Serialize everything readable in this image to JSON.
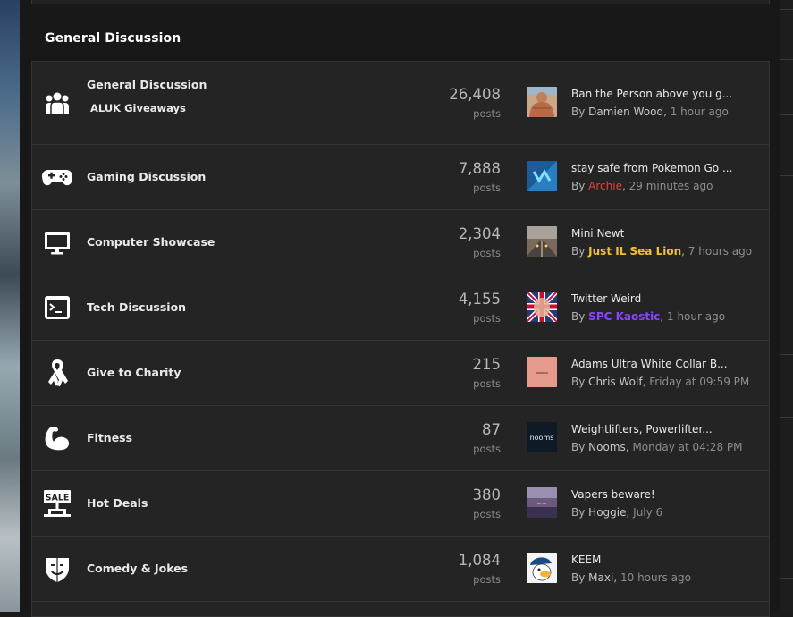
{
  "section": {
    "title": "General Discussion"
  },
  "forums": [
    {
      "name": "General Discussion",
      "subforum": "ALUK Giveaways",
      "icon": "users-group-icon",
      "count": "26,408",
      "count_label": "posts",
      "thread": "Ban the Person above you g...",
      "by": "By",
      "user": "Damien Wood",
      "sep": ",",
      "time": "1 hour ago",
      "user_style": "normal",
      "thumb": "avatar-muscle"
    },
    {
      "name": "Gaming Discussion",
      "icon": "gamepad-icon",
      "count": "7,888",
      "count_label": "posts",
      "thread": "stay safe from Pokemon Go ...",
      "by": "By",
      "user": "Archie",
      "sep": ",",
      "time": "29 minutes ago",
      "user_style": "red",
      "thumb": "avatar-blue"
    },
    {
      "name": "Computer Showcase",
      "icon": "monitor-icon",
      "count": "2,304",
      "count_label": "posts",
      "thread": "Mini Newt",
      "by": "By",
      "user": "Just IL Sea Lion",
      "sep": ",",
      "time": "7 hours ago",
      "user_style": "gold",
      "thumb": "avatar-runway"
    },
    {
      "name": "Tech Discussion",
      "icon": "terminal-icon",
      "count": "4,155",
      "count_label": "posts",
      "thread": "Twitter Weird",
      "by": "By",
      "user": "SPC Kaostic",
      "sep": ",",
      "time": "1 hour ago",
      "user_style": "purple",
      "thumb": "avatar-flag"
    },
    {
      "name": "Give to Charity",
      "icon": "ribbon-icon",
      "count": "215",
      "count_label": "posts",
      "thread": "Adams Ultra White Collar B...",
      "by": "By",
      "user": "Chris Wolf",
      "sep": ",",
      "time": "Friday at 09:59 PM",
      "user_style": "normal",
      "thumb": "avatar-pink"
    },
    {
      "name": "Fitness",
      "icon": "bicep-icon",
      "count": "87",
      "count_label": "posts",
      "thread": "Weightlifters, Powerlifter...",
      "by": "By",
      "user": "Nooms",
      "sep": ",",
      "time": "Monday at 04:28 PM",
      "user_style": "normal",
      "thumb": "avatar-nooms",
      "thumb_text": "nooms"
    },
    {
      "name": "Hot Deals",
      "icon": "sale-sign-icon",
      "count": "380",
      "count_label": "posts",
      "thread": "Vapers beware!",
      "by": "By",
      "user": "Hoggie",
      "sep": ",",
      "time": "July 6",
      "user_style": "normal",
      "thumb": "avatar-purple"
    },
    {
      "name": "Comedy & Jokes",
      "icon": "theater-mask-icon",
      "count": "1,084",
      "count_label": "posts",
      "thread": "KEEM",
      "by": "By",
      "user": "Maxi",
      "sep": ",",
      "time": "10 hours ago",
      "user_style": "normal",
      "thumb": "avatar-duck"
    }
  ],
  "icon_texts": {
    "sale": "SALE"
  },
  "colors": {
    "background": "#181818",
    "row": "#242424",
    "border": "#343434",
    "red_user": "#e0453a",
    "gold_user": "#f2c22e",
    "purple_user": "#8a45ff"
  }
}
